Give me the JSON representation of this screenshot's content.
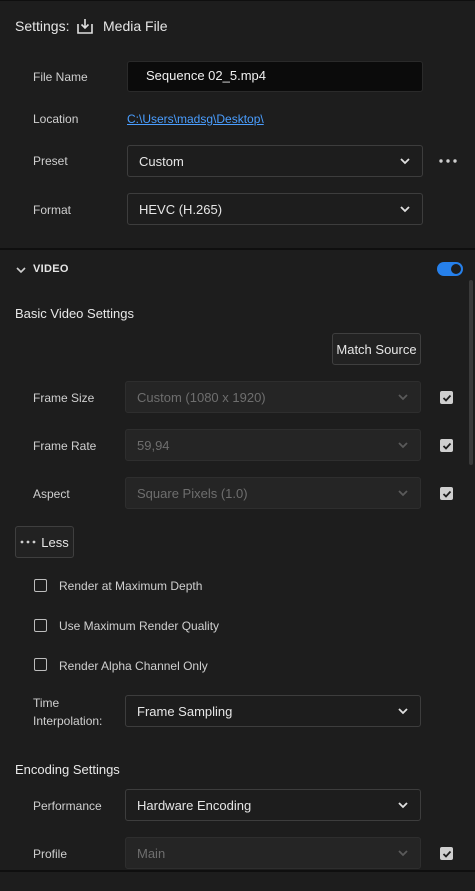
{
  "header": {
    "settings_label": "Settings:",
    "media_label": "Media File"
  },
  "file": {
    "file_name_label": "File Name",
    "file_name_value": "Sequence 02_5.mp4",
    "location_label": "Location",
    "location_value": "C:\\Users\\madsg\\Desktop\\",
    "preset_label": "Preset",
    "preset_value": "Custom",
    "format_label": "Format",
    "format_value": "HEVC (H.265)"
  },
  "video": {
    "section_label": "VIDEO",
    "toggle_on": true,
    "basic_title": "Basic Video Settings",
    "match_source_label": "Match Source",
    "frame_size_label": "Frame Size",
    "frame_size_value": "Custom (1080 x 1920)",
    "frame_rate_label": "Frame Rate",
    "frame_rate_value": "59,94",
    "aspect_label": "Aspect",
    "aspect_value": "Square Pixels (1.0)",
    "less_label": "Less",
    "render_max_depth": "Render at Maximum Depth",
    "max_render_quality": "Use Maximum Render Quality",
    "render_alpha": "Render Alpha Channel Only",
    "time_interp_label_1": "Time",
    "time_interp_label_2": "Interpolation:",
    "time_interp_value": "Frame Sampling",
    "encoding_title": "Encoding Settings",
    "performance_label": "Performance",
    "performance_value": "Hardware Encoding",
    "profile_label": "Profile",
    "profile_value": "Main"
  },
  "colors": {
    "accent": "#2680eb",
    "link": "#4a9eff",
    "background": "#1d1d1d"
  }
}
